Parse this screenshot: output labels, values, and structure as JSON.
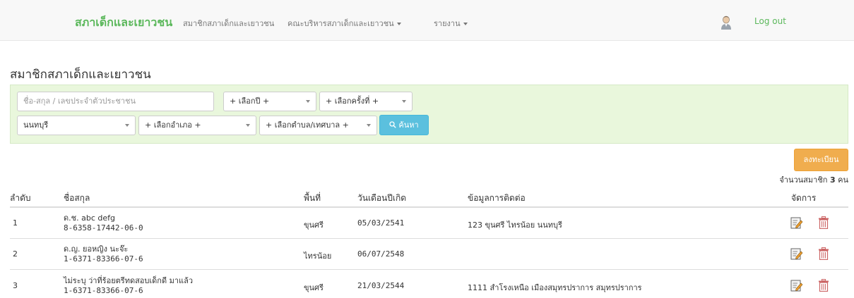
{
  "navbar": {
    "brand": "สภาเด็กและเยาวชน",
    "links": [
      {
        "label": "สมาชิกสภาเด็กและเยาวชน"
      },
      {
        "label": "คณะบริหารสภาเด็กและเยาวชน"
      },
      {
        "label": "รายงาน"
      }
    ],
    "logout": "Log out"
  },
  "page": {
    "title": "สมาชิกสภาเด็กและเยาวชน"
  },
  "filters": {
    "name_placeholder": "ชื่อ-สกุล / เลขประจำตัวประชาชน",
    "year": "+ เลือกปี +",
    "round": "+ เลือกครั้งที่ +",
    "province": "นนทบุรี",
    "district": "+ เลือกอำเภอ +",
    "subdistrict": "+ เลือกตำบล/เทศบาล +",
    "search_label": "ค้นหา"
  },
  "actions": {
    "register_label": "ลงทะเบียน",
    "member_count_prefix": "จำนวนสมาชิก",
    "member_count": "3",
    "member_count_suffix": "คน"
  },
  "table": {
    "headers": [
      "ลำดับ",
      "ชื่อสกุล",
      "พื้นที่",
      "วันเดือนปีเกิด",
      "ข้อมูลการติดต่อ",
      "จัดการ"
    ],
    "rows": [
      {
        "no": "1",
        "name": "ด.ช. abc defg",
        "id": "8-6358-17442-06-0",
        "area": "ขุนศรี",
        "dob": "05/03/2541",
        "contact": "123 ขุนศรี ไทรน้อย นนทบุรี"
      },
      {
        "no": "2",
        "name": "ด.ญ. ยอหญิง นะจ๊ะ",
        "id": "1-6371-83366-07-6",
        "area": "ไทรน้อย",
        "dob": "06/07/2548",
        "contact": ""
      },
      {
        "no": "3",
        "name": "ไม่ระบุ ว่าที่ร้อยตรีทดสอบเด็กดี มาแล้ว",
        "id": "1-6371-83366-07-6",
        "area": "ขุนศรี",
        "dob": "21/03/2544",
        "contact": "1111 สำโรงเหนือ เมืองสมุทรปราการ สมุทรปราการ"
      }
    ]
  },
  "icons": {
    "user": "user-avatar-icon",
    "search": "search-icon",
    "edit": "edit-icon",
    "delete": "trash-icon"
  },
  "colors": {
    "brand": "#5cb85c",
    "filter_bg": "#e9f7dc",
    "search_btn": "#5bc0de",
    "register_btn": "#f0ad4e"
  }
}
